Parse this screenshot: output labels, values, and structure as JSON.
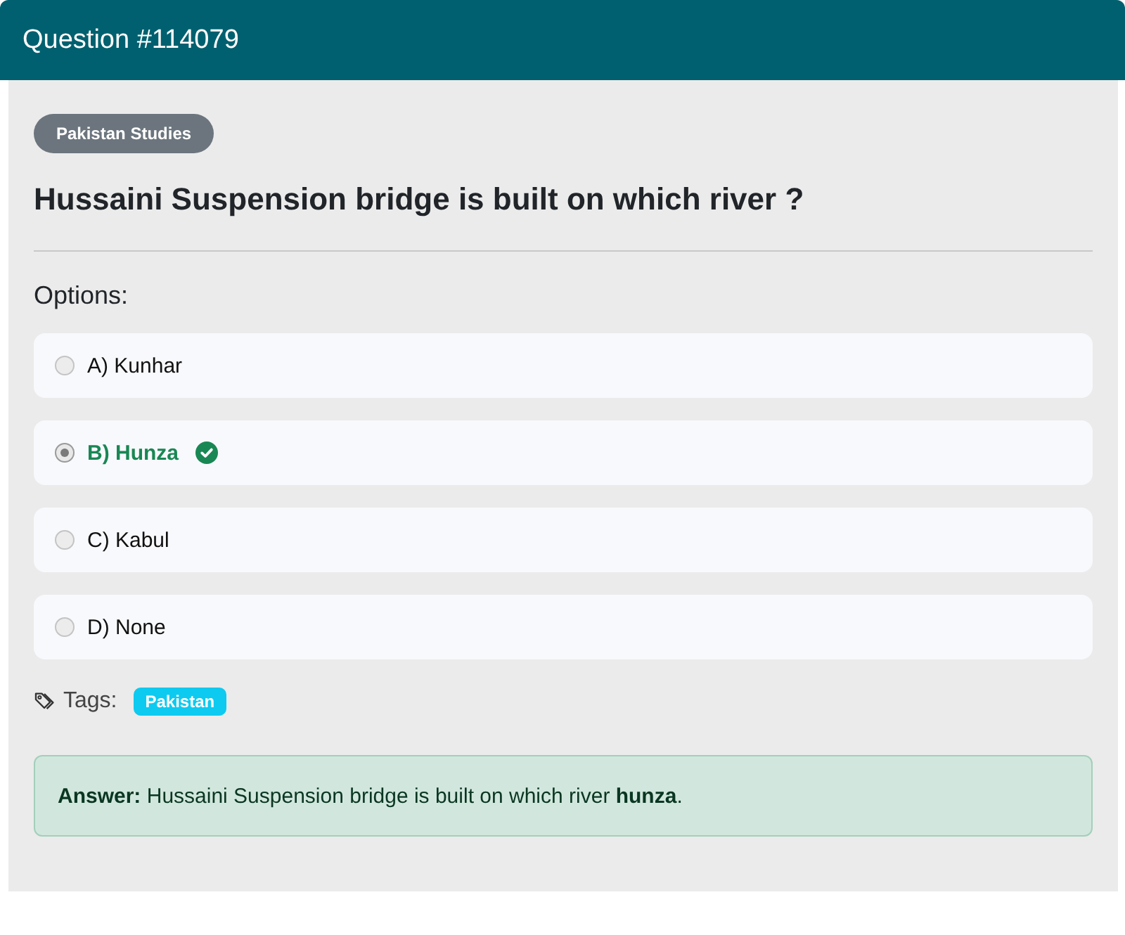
{
  "header": {
    "title": "Question #114079"
  },
  "category": "Pakistan Studies",
  "question": "Hussaini Suspension bridge is built on which river ?",
  "options_label": "Options:",
  "options": [
    {
      "label": "A) Kunhar",
      "selected": false,
      "correct": false
    },
    {
      "label": "B) Hunza",
      "selected": true,
      "correct": true
    },
    {
      "label": "C) Kabul",
      "selected": false,
      "correct": false
    },
    {
      "label": "D) None",
      "selected": false,
      "correct": false
    }
  ],
  "tags": {
    "label": "Tags:",
    "items": [
      "Pakistan"
    ]
  },
  "answer": "**Answer:** Hussaini Suspension bridge is built on which river **hunza**."
}
